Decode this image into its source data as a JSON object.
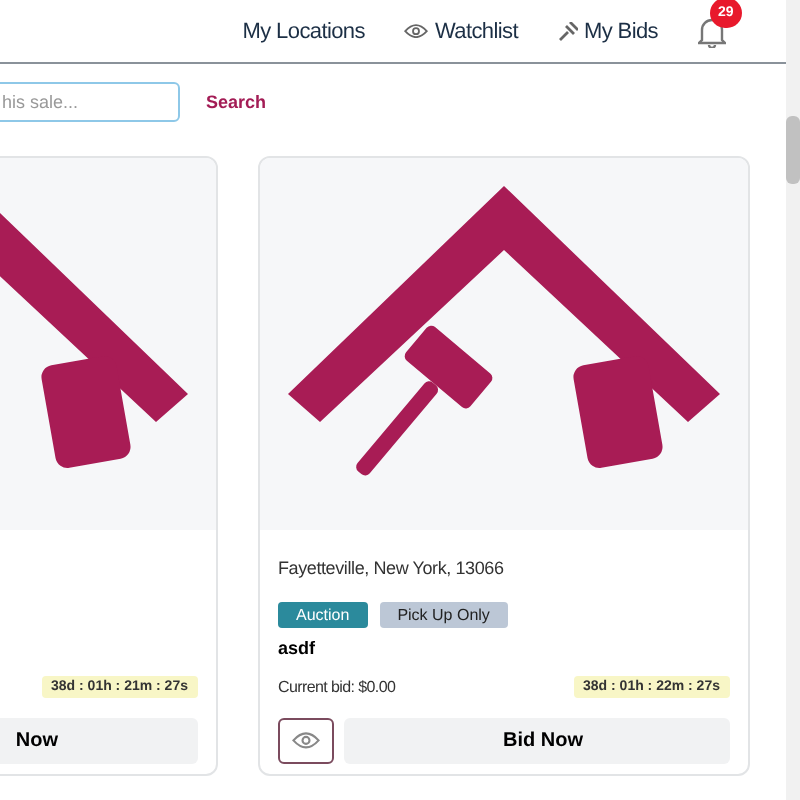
{
  "nav": {
    "items": [
      {
        "label": "My Locations"
      },
      {
        "label": "Watchlist"
      },
      {
        "label": "My Bids"
      }
    ],
    "notifications": {
      "count": "29"
    }
  },
  "search": {
    "placeholder": "his sale...",
    "button": "Search"
  },
  "cards": [
    {
      "timer": "38d : 01h : 21m : 27s",
      "bid_button": "Now"
    },
    {
      "location": "Fayetteville, New York, 13066",
      "tags": [
        {
          "label": "Auction",
          "kind": "auction"
        },
        {
          "label": "Pick Up Only",
          "kind": "pickup"
        }
      ],
      "title": "asdf",
      "bid": "Current bid: $0.00",
      "timer": "38d : 01h : 22m : 27s",
      "bid_button": "Bid Now"
    }
  ]
}
